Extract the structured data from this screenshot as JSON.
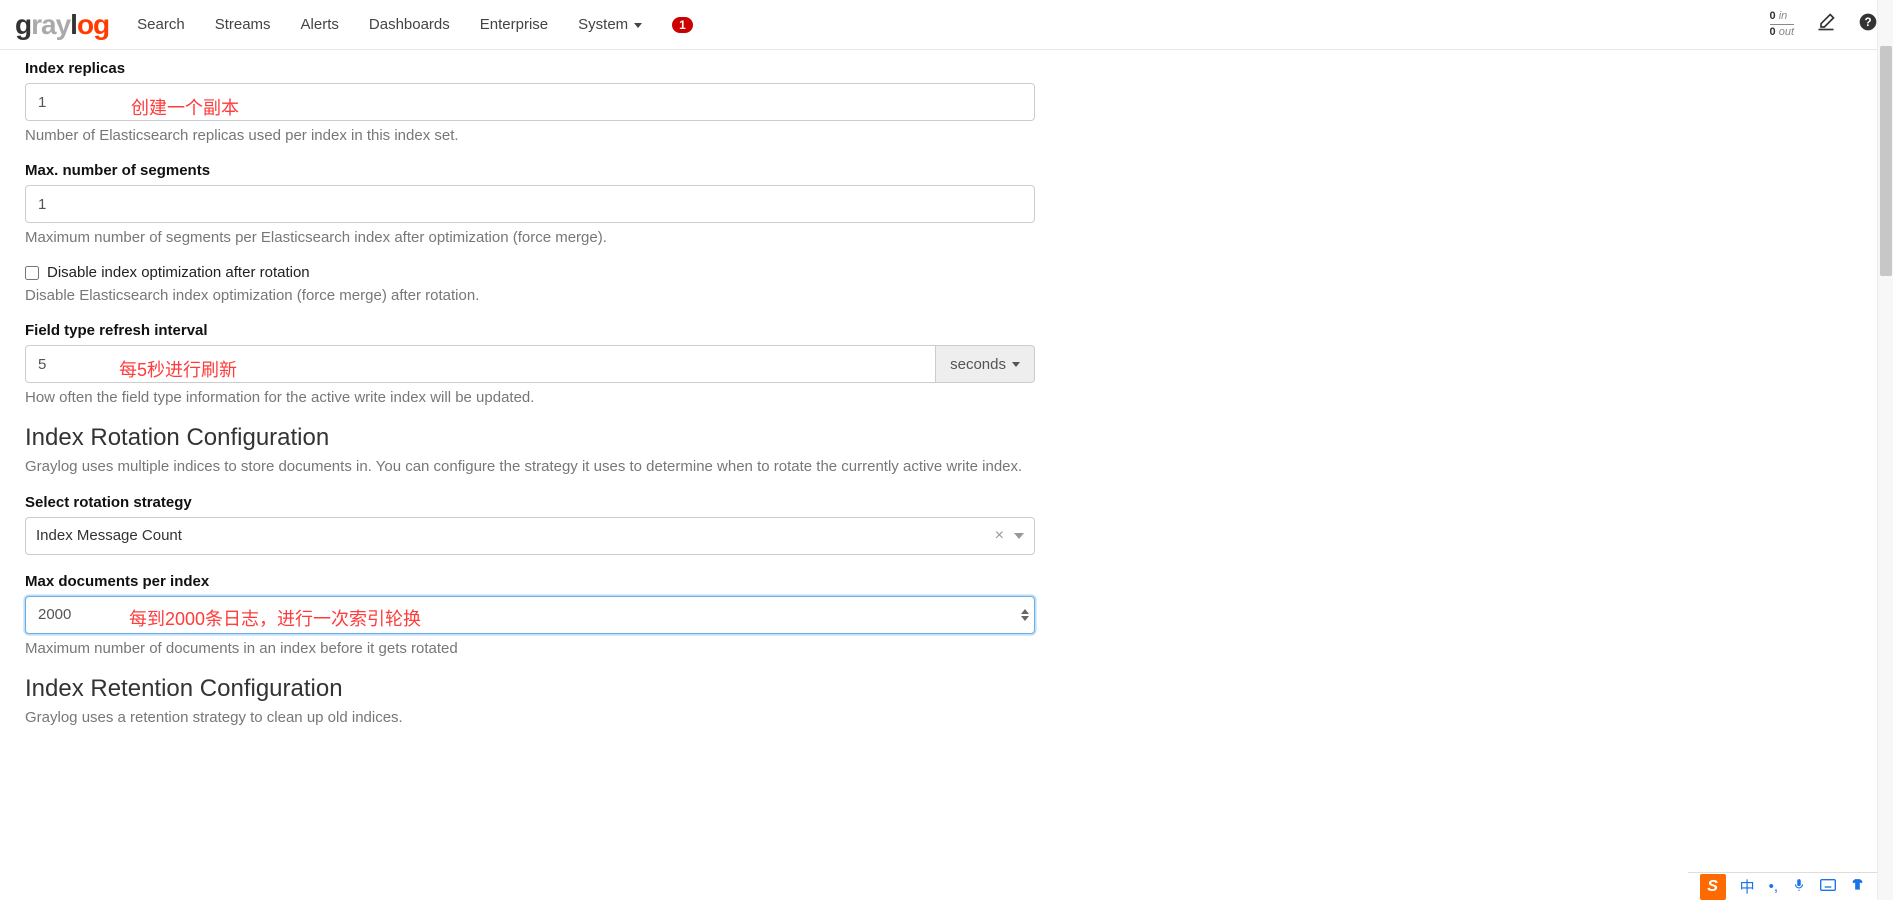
{
  "nav": {
    "items": [
      "Search",
      "Streams",
      "Alerts",
      "Dashboards",
      "Enterprise",
      "System"
    ],
    "badge": "1",
    "throughput_in_n": "0",
    "throughput_in_l": "in",
    "throughput_out_n": "0",
    "throughput_out_l": "out"
  },
  "form": {
    "index_replicas": {
      "label": "Index replicas",
      "value": "1",
      "help": "Number of Elasticsearch replicas used per index in this index set."
    },
    "max_segments": {
      "label": "Max. number of segments",
      "value": "1",
      "help": "Maximum number of segments per Elasticsearch index after optimization (force merge)."
    },
    "disable_opt": {
      "label": "Disable index optimization after rotation",
      "help": "Disable Elasticsearch index optimization (force merge) after rotation."
    },
    "refresh_interval": {
      "label": "Field type refresh interval",
      "value": "5",
      "unit": "seconds",
      "help": "How often the field type information for the active write index will be updated."
    },
    "rotation": {
      "heading": "Index Rotation Configuration",
      "desc": "Graylog uses multiple indices to store documents in. You can configure the strategy it uses to determine when to rotate the currently active write index.",
      "strategy_label": "Select rotation strategy",
      "strategy_value": "Index Message Count",
      "max_docs_label": "Max documents per index",
      "max_docs_value": "2000",
      "max_docs_help": "Maximum number of documents in an index before it gets rotated"
    },
    "retention": {
      "heading": "Index Retention Configuration",
      "desc": "Graylog uses a retention strategy to clean up old indices."
    }
  },
  "annotations": {
    "a1": "创建一个副本",
    "a2": "每5秒进行刷新",
    "a3": "每到2000条日志，进行一次索引轮换"
  },
  "ime": {
    "lang": "中"
  }
}
